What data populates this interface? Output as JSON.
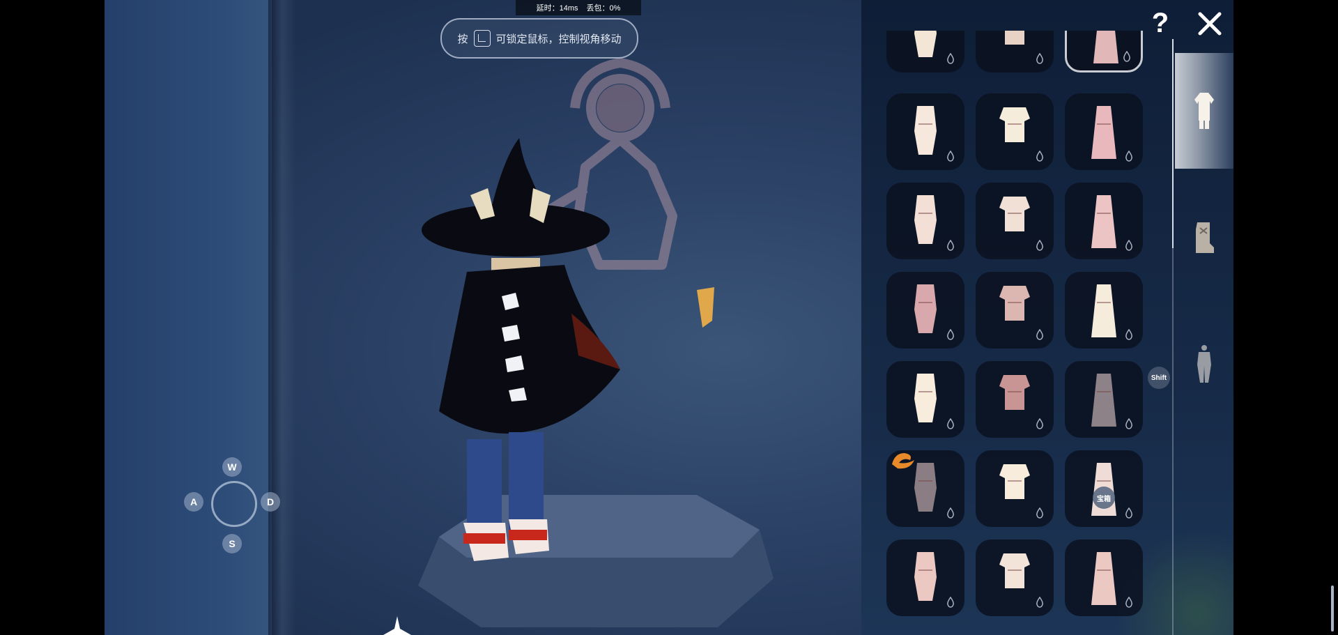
{
  "hud": {
    "latency": "延时：14ms",
    "packet_loss": "丢包：0%"
  },
  "hint": {
    "prefix": "按",
    "suffix": "可锁定鼠标，控制视角移动"
  },
  "controls": {
    "up": "W",
    "left": "A",
    "right": "D",
    "down": "S"
  },
  "panel": {
    "help_label": "?",
    "shift_label": "Shift",
    "badge_label": "宝箱",
    "tabs": [
      "outfit-tab",
      "shoes-tab",
      "pants-tab"
    ],
    "items": [
      {
        "icon": "dress-icon",
        "color": "#f4e6d6",
        "selected": false
      },
      {
        "icon": "shorts-outfit-icon",
        "color": "#e8d2c6",
        "selected": false
      },
      {
        "icon": "robe-icon",
        "color": "#e2b7b7",
        "selected": true
      },
      {
        "icon": "skirt-outfit-icon",
        "color": "#f6e8dc",
        "selected": false
      },
      {
        "icon": "long-robe-icon",
        "color": "#f6ecdc",
        "selected": false
      },
      {
        "icon": "gown-icon",
        "color": "#e8b8bd",
        "selected": false
      },
      {
        "icon": "martial-outfit-icon",
        "color": "#f4dfd6",
        "selected": false
      },
      {
        "icon": "hanfu-robe-icon",
        "color": "#f0e0d6",
        "selected": false
      },
      {
        "icon": "vest-outfit-icon",
        "color": "#ecc4c4",
        "selected": false
      },
      {
        "icon": "tiered-dress-icon",
        "color": "#d9a8ac",
        "selected": false
      },
      {
        "icon": "sleeveless-dress-icon",
        "color": "#dcb6b0",
        "selected": false
      },
      {
        "icon": "ruffle-dress-icon",
        "color": "#f6ecdc",
        "selected": false
      },
      {
        "icon": "slip-dress-icon",
        "color": "#f8ecdc",
        "selected": false
      },
      {
        "icon": "coat-icon",
        "color": "#c99494",
        "selected": false
      },
      {
        "icon": "grey-coat-icon",
        "color": "#8d8288",
        "selected": false
      },
      {
        "icon": "ball-gown-icon",
        "color": "#8a7d84",
        "selected": false
      },
      {
        "icon": "tshirt-outfit-icon",
        "color": "#f8ecdc",
        "selected": false
      },
      {
        "icon": "apron-dress-icon",
        "color": "#f0dcd6",
        "selected": false
      },
      {
        "icon": "tunic-outfit-icon",
        "color": "#ecc8c2",
        "selected": false
      },
      {
        "icon": "overalls-icon",
        "color": "#f3e4da",
        "selected": false
      },
      {
        "icon": "trench-coat-icon",
        "color": "#ecc8c2",
        "selected": false
      }
    ]
  },
  "colors": {
    "panel_bg": "#162a47",
    "cell_bg": "#0a1220",
    "accent_white": "#d8dde6"
  }
}
